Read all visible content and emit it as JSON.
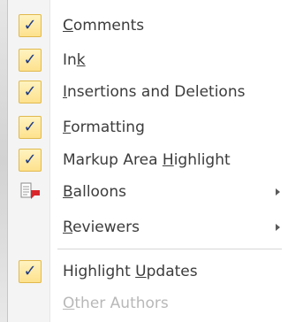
{
  "menu": {
    "items": [
      {
        "pre": "",
        "u": "C",
        "post": "omments",
        "checked": true
      },
      {
        "pre": "In",
        "u": "k",
        "post": "",
        "checked": true
      },
      {
        "pre": "",
        "u": "I",
        "post": "nsertions and Deletions",
        "checked": true
      },
      {
        "pre": "",
        "u": "F",
        "post": "ormatting",
        "checked": true
      },
      {
        "pre": "Markup Area ",
        "u": "H",
        "post": "ighlight",
        "checked": true
      },
      {
        "pre": "",
        "u": "B",
        "post": "alloons",
        "checked": false,
        "icon": "balloons-icon",
        "submenu": true
      },
      {
        "pre": "",
        "u": "R",
        "post": "eviewers",
        "checked": false,
        "submenu": true
      },
      {
        "pre": "Highlight ",
        "u": "U",
        "post": "pdates",
        "checked": true
      },
      {
        "pre": "",
        "u": "O",
        "post": "ther Authors",
        "checked": false,
        "disabled": true
      }
    ],
    "check_glyph": "✓",
    "colors": {
      "check_border": "#e0b94d",
      "check_fill": "#fde18d",
      "check_mark": "#1f3b86",
      "text": "#3c3c3c",
      "disabled_text": "#b8b8b8",
      "balloon_red": "#d9262b"
    }
  }
}
